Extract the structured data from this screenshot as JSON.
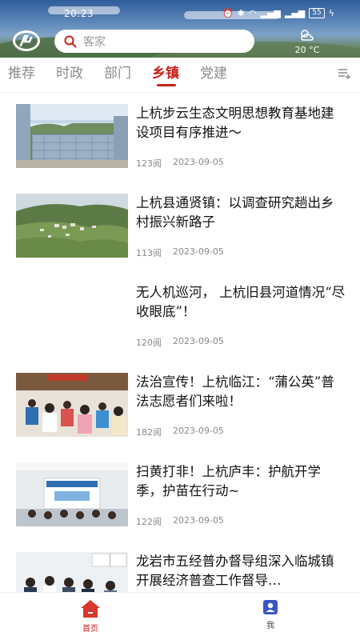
{
  "status": {
    "time": "20:23",
    "battery": "55"
  },
  "search": {
    "placeholder": "客家"
  },
  "weather": {
    "temp": "20 °C",
    "icon": "partly-cloudy-icon"
  },
  "tabs": [
    {
      "label": "推荐",
      "active": false
    },
    {
      "label": "时政",
      "active": false
    },
    {
      "label": "部门",
      "active": false
    },
    {
      "label": "乡镇",
      "active": true
    },
    {
      "label": "党建",
      "active": false
    }
  ],
  "articles": [
    {
      "title": "上杭步云生态文明思想教育基地建设项目有序推进～",
      "reads": "123阅",
      "date": "2023-09-05",
      "image": "construction-building"
    },
    {
      "title": "上杭县通贤镇：以调查研究趟出乡村振兴新路子",
      "reads": "113阅",
      "date": "2023-09-05",
      "image": "rural-village"
    },
    {
      "title": "无人机巡河， 上杭旧县河道情况“尽收眼底”！",
      "reads": "120阅",
      "date": "2023-09-05",
      "image": ""
    },
    {
      "title": "法治宣传！上杭临江：“蒲公英”普法志愿者们来啦！",
      "reads": "182阅",
      "date": "2023-09-05",
      "image": "volunteer-event"
    },
    {
      "title": "扫黄打非！上杭庐丰：护航开学季，护苗在行动~",
      "reads": "122阅",
      "date": "2023-09-05",
      "image": "classroom-meeting"
    },
    {
      "title": "龙岩市五经普办督导组深入临城镇开展经济普查工作督导…",
      "reads": "",
      "date": "",
      "image": "office-meeting"
    }
  ],
  "bottom_nav": {
    "home": "首页",
    "me": "我"
  },
  "colors": {
    "accent": "#c8201a"
  }
}
